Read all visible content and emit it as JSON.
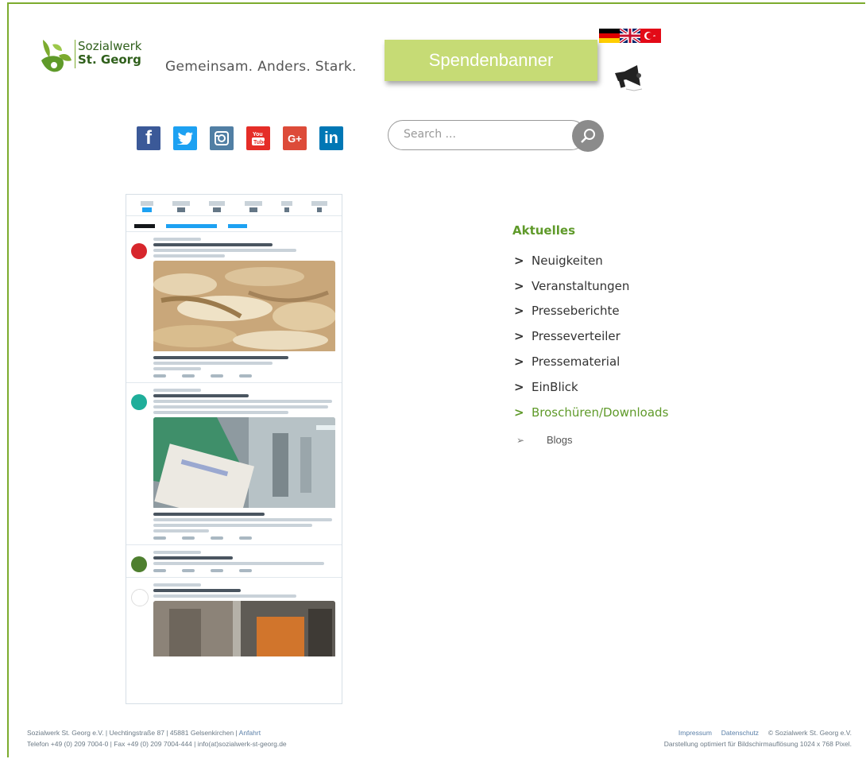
{
  "header": {
    "logo_line1": "Sozialwerk",
    "logo_line2": "St. Georg",
    "tagline": "Gemeinsam. Anders. Stark.",
    "spenden_label": "Spendenbanner"
  },
  "languages": [
    {
      "name": "de-flag-icon"
    },
    {
      "name": "uk-flag-icon"
    },
    {
      "name": "tr-flag-icon"
    }
  ],
  "social": [
    {
      "name": "facebook-icon",
      "glyph": "f",
      "color": "#3b5998"
    },
    {
      "name": "twitter-icon",
      "glyph": "🐦",
      "color": "#1da1f2"
    },
    {
      "name": "instagram-icon",
      "glyph": "◎",
      "color": "#517fa4"
    },
    {
      "name": "youtube-icon",
      "glyph": "▶",
      "color": "#e52d27"
    },
    {
      "name": "googleplus-icon",
      "glyph": "G+",
      "color": "#dd4b39"
    },
    {
      "name": "linkedin-icon",
      "glyph": "in",
      "color": "#0077b5"
    }
  ],
  "search": {
    "placeholder": "Search ..."
  },
  "menu": {
    "title": "Aktuelles",
    "items": [
      {
        "label": "Neuigkeiten",
        "active": false
      },
      {
        "label": "Veranstaltungen",
        "active": false
      },
      {
        "label": "Presseberichte",
        "active": false
      },
      {
        "label": "Presseverteiler",
        "active": false
      },
      {
        "label": "Pressematerial",
        "active": false
      },
      {
        "label": "EinBlick",
        "active": false
      },
      {
        "label": "Broschüren/Downloads",
        "active": true
      }
    ],
    "blogs_label": "Blogs"
  },
  "footer": {
    "left_line1_a": "Sozialwerk St. Georg e.V. | Uechtingstraße 87 | 45881 Gelsenkirchen | ",
    "left_line1_link": "Anfahrt",
    "left_line2": "Telefon +49 (0) 209 7004-0 | Fax +49 (0) 209 7004-444 | info(at)sozialwerk-st-georg.de",
    "impressum": "Impressum",
    "datenschutz": "Datenschutz",
    "copyright": "© Sozialwerk St. Georg e.V.",
    "resolution": "Darstellung optimiert für Bildschirmauflösung 1024 x 768 Pixel."
  },
  "colors": {
    "brand_green": "#5f9a2a",
    "spenden_bg": "#c6db75"
  }
}
